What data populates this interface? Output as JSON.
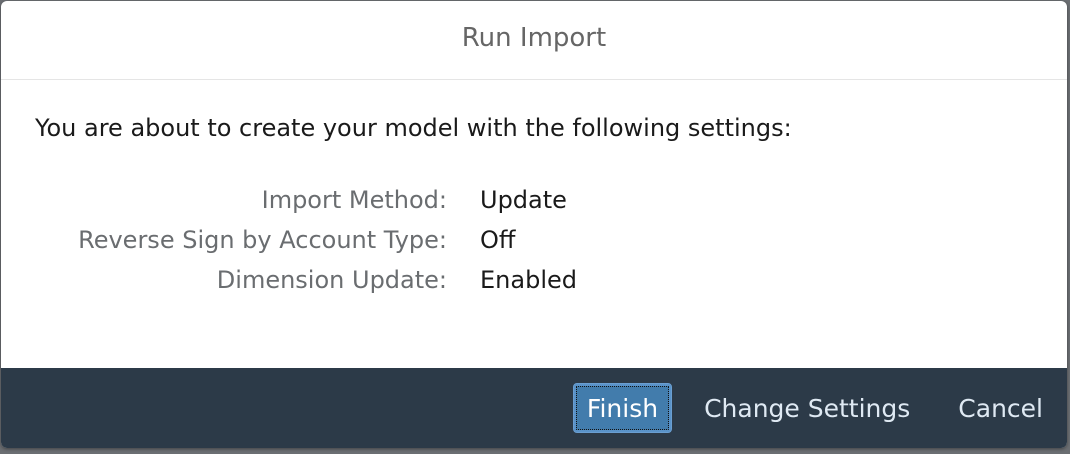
{
  "dialog": {
    "title": "Run Import",
    "intro": "You are about to create your model with the following settings:",
    "settings": [
      {
        "label": "Import Method:",
        "value": "Update"
      },
      {
        "label": "Reverse Sign by Account Type:",
        "value": "Off"
      },
      {
        "label": "Dimension Update:",
        "value": "Enabled"
      }
    ]
  },
  "footer": {
    "finish_label": "Finish",
    "change_settings_label": "Change Settings",
    "cancel_label": "Cancel"
  },
  "colors": {
    "footer_bg": "#2c3a48",
    "primary_button": "#427cac"
  }
}
